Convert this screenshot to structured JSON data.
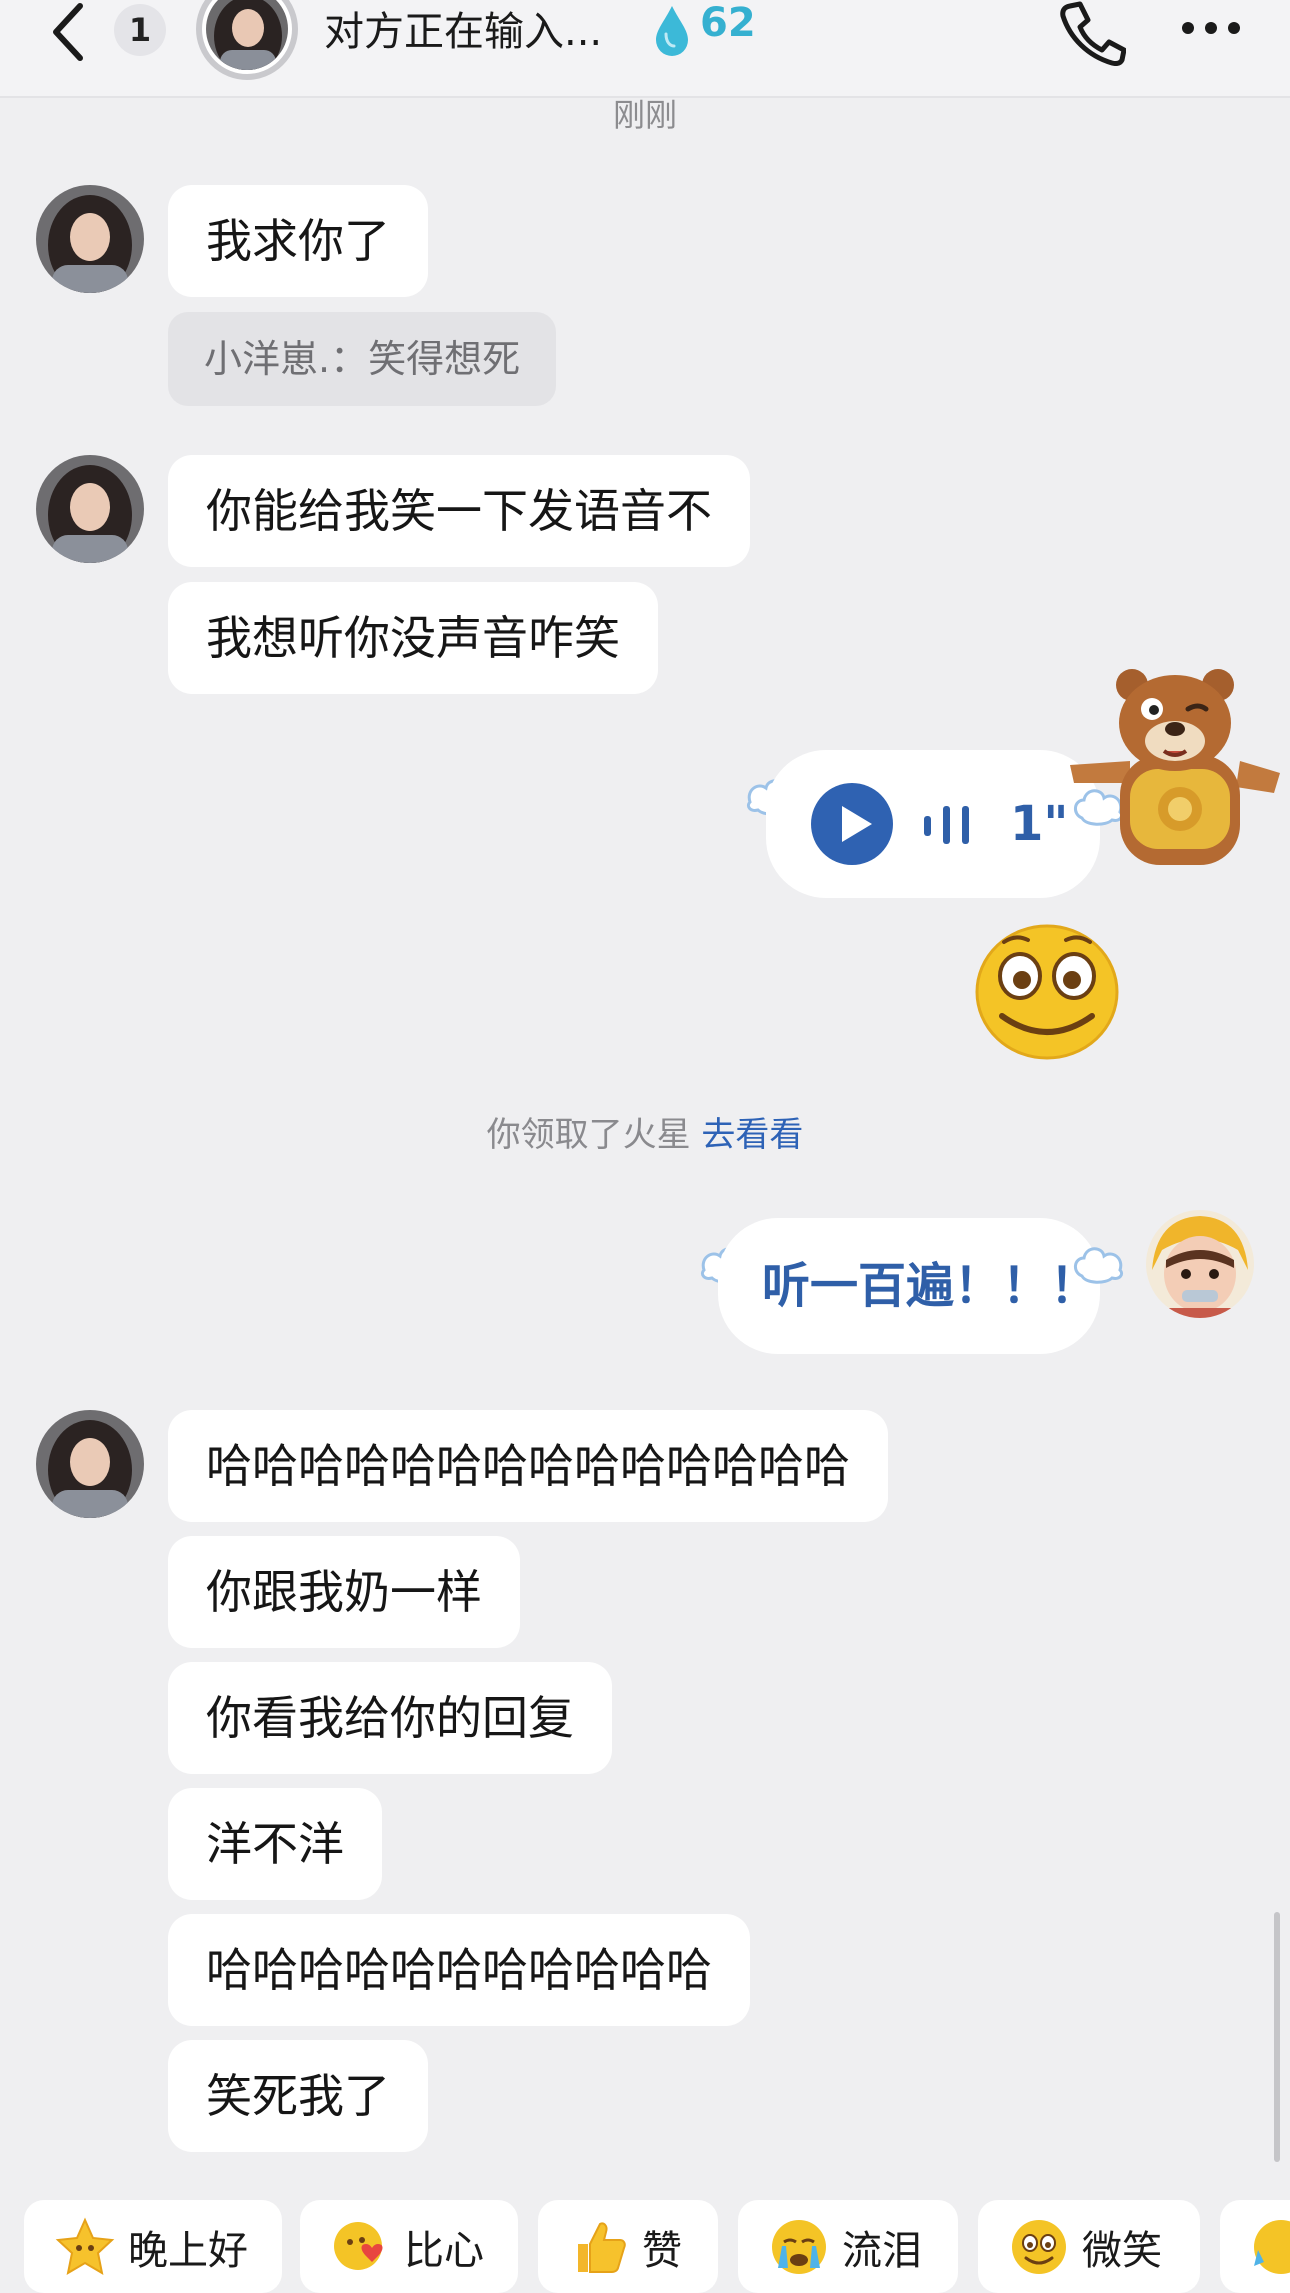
{
  "header": {
    "unread_count": "1",
    "title": "对方正在输入...",
    "spark_count": "62"
  },
  "timestamp": "刚刚",
  "messages": {
    "m1": "我求你了",
    "quote": "小洋崽.：笑得想死",
    "m2": "你能给我笑一下发语音不",
    "m3": "我想听你没声音咋笑",
    "voice_duration": "1\"",
    "sent_text": "听一百遍！！！",
    "m4": "哈哈哈哈哈哈哈哈哈哈哈哈哈哈",
    "m5": "你跟我奶一样",
    "m6": "你看我给你的回复",
    "m7": "洋不洋",
    "m8": "哈哈哈哈哈哈哈哈哈哈哈",
    "m9": "笑死我了"
  },
  "system_note": {
    "text": "你领取了火星",
    "link": "去看看"
  },
  "quick_replies": [
    "晚上好",
    "比心",
    "赞",
    "流泪",
    "微笑"
  ],
  "colors": {
    "background": "#efeff1",
    "bubble": "#ffffff",
    "sent_text": "#2f5fa8",
    "link": "#2d62b6",
    "spark": "#35b0d0",
    "voice_play": "#2f62b2"
  },
  "icons": [
    "back-arrow-icon",
    "fire-drop-icon",
    "phone-icon",
    "more-dots-icon",
    "play-icon",
    "voice-wave-icon",
    "smile-emoji-icon",
    "bear-sticker-icon",
    "star-icon",
    "heart-hands-icon",
    "thumbs-up-icon",
    "crying-icon",
    "smile-icon"
  ]
}
